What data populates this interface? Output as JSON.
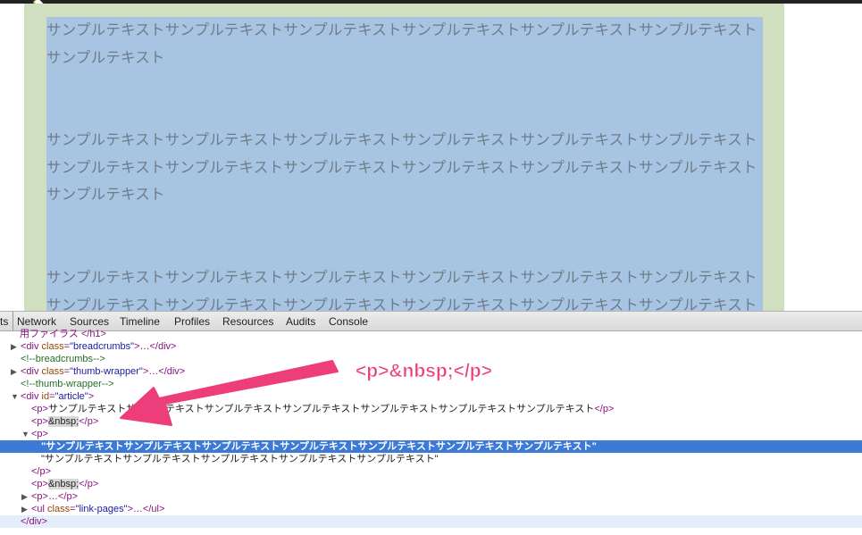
{
  "page": {
    "paragraphs": [
      "サンプルテキストサンプルテキストサンプルテキストサンプルテキストサンプルテキストサンプルテキストサンプルテキスト",
      "サンプルテキストサンプルテキストサンプルテキストサンプルテキストサンプルテキストサンプルテキストサンプルテキストサンプルテキストサンプルテキストサンプルテキストサンプルテキストサンプルテキストサンプルテキスト",
      "サンプルテキストサンプルテキストサンプルテキストサンプルテキストサンプルテキストサンプルテキストサンプルテキストサンプルテキストサンプルテキストサンプルテキストサンプルテキストサンプルテキスト"
    ]
  },
  "devtools": {
    "tab_partial": "ts",
    "tabs": [
      "Network",
      "Sources",
      "Timeline",
      "Profiles",
      "Resources",
      "Audits",
      "Console"
    ],
    "rows": {
      "r0": "用ファイラス </h1>",
      "r1_tag_open": "<div ",
      "r1_attr": "class",
      "r1_val": "\"breadcrumbs\"",
      "r1_end": ">…</div>",
      "r2": "<!--breadcrumbs-->",
      "r3_tag_open": "<div ",
      "r3_attr": "class",
      "r3_val": "\"thumb-wrapper\"",
      "r3_end": ">…</div>",
      "r4": "<!--thumb-wrapper-->",
      "r5_tag_open": "<div ",
      "r5_attr": "id",
      "r5_val": "\"article\"",
      "r5_end": ">",
      "r6_open": "<p>",
      "r6_text": "サンプルテキストサンプルテキストサンプルテキストサンプルテキストサンプルテキストサンプルテキストサンプルテキスト",
      "r6_close": "</p>",
      "r7_open": "<p>",
      "r7_entity": "&nbsp;",
      "r7_close": "</p>",
      "r8": "<p>",
      "r9": "\"サンプルテキストサンプルテキストサンプルテキストサンプルテキストサンプルテキストサンプルテキストサンプルテキスト\"",
      "r10": "\"サンプルテキストサンプルテキストサンプルテキストサンプルテキストサンプルテキスト\"",
      "r11": "</p>",
      "r12_open": "<p>",
      "r12_entity": "&nbsp;",
      "r12_close": "</p>",
      "r13": "<p>…</p>",
      "r14_tag_open": "<ul ",
      "r14_attr": "class",
      "r14_val": "\"link-pages\"",
      "r14_end": ">…</ul>",
      "r15": "</div>"
    }
  },
  "annotation": {
    "label": "<p>&nbsp;</p>",
    "color": "#ee3d7b"
  },
  "colors": {
    "selected_row": "#3d7ad6",
    "page_blue": "#a7c4e2",
    "page_green": "#cfdfbf"
  }
}
